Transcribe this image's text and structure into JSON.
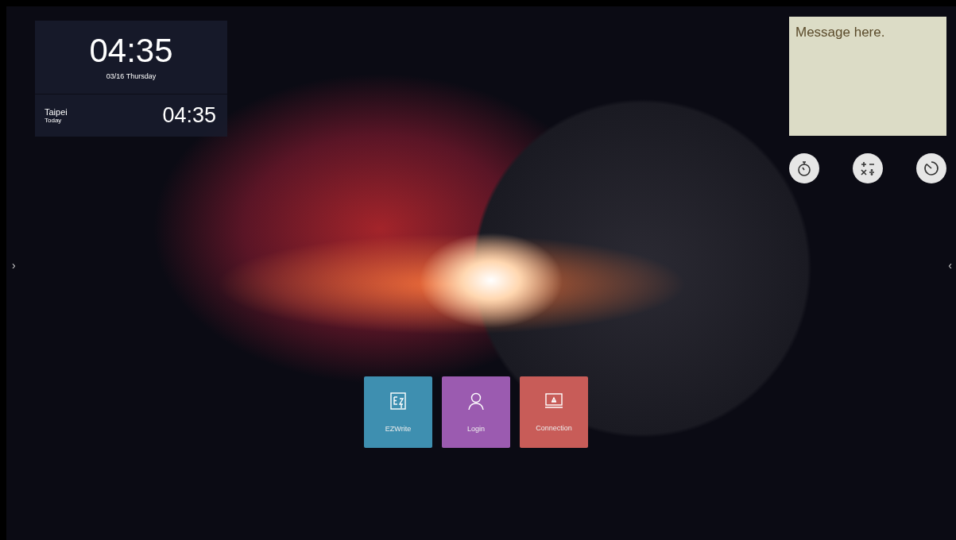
{
  "clock_widget": {
    "time": "04:35",
    "date": "03/16 Thursday",
    "world_clock": {
      "city": "Taipei",
      "day": "Today",
      "time": "04:35"
    }
  },
  "sticky_note": {
    "text": "Message here."
  },
  "tools": [
    {
      "kind": "stopwatch"
    },
    {
      "kind": "calculator"
    },
    {
      "kind": "timer"
    }
  ],
  "side_arrows": {
    "left": "›",
    "right": "‹"
  },
  "apps": [
    {
      "label": "EZWrite",
      "kind": "write",
      "color": "#3e8fb0"
    },
    {
      "label": "Login",
      "kind": "user",
      "color": "#9b5bb0"
    },
    {
      "label": "Connection",
      "kind": "screen",
      "color": "#c85c58"
    }
  ]
}
